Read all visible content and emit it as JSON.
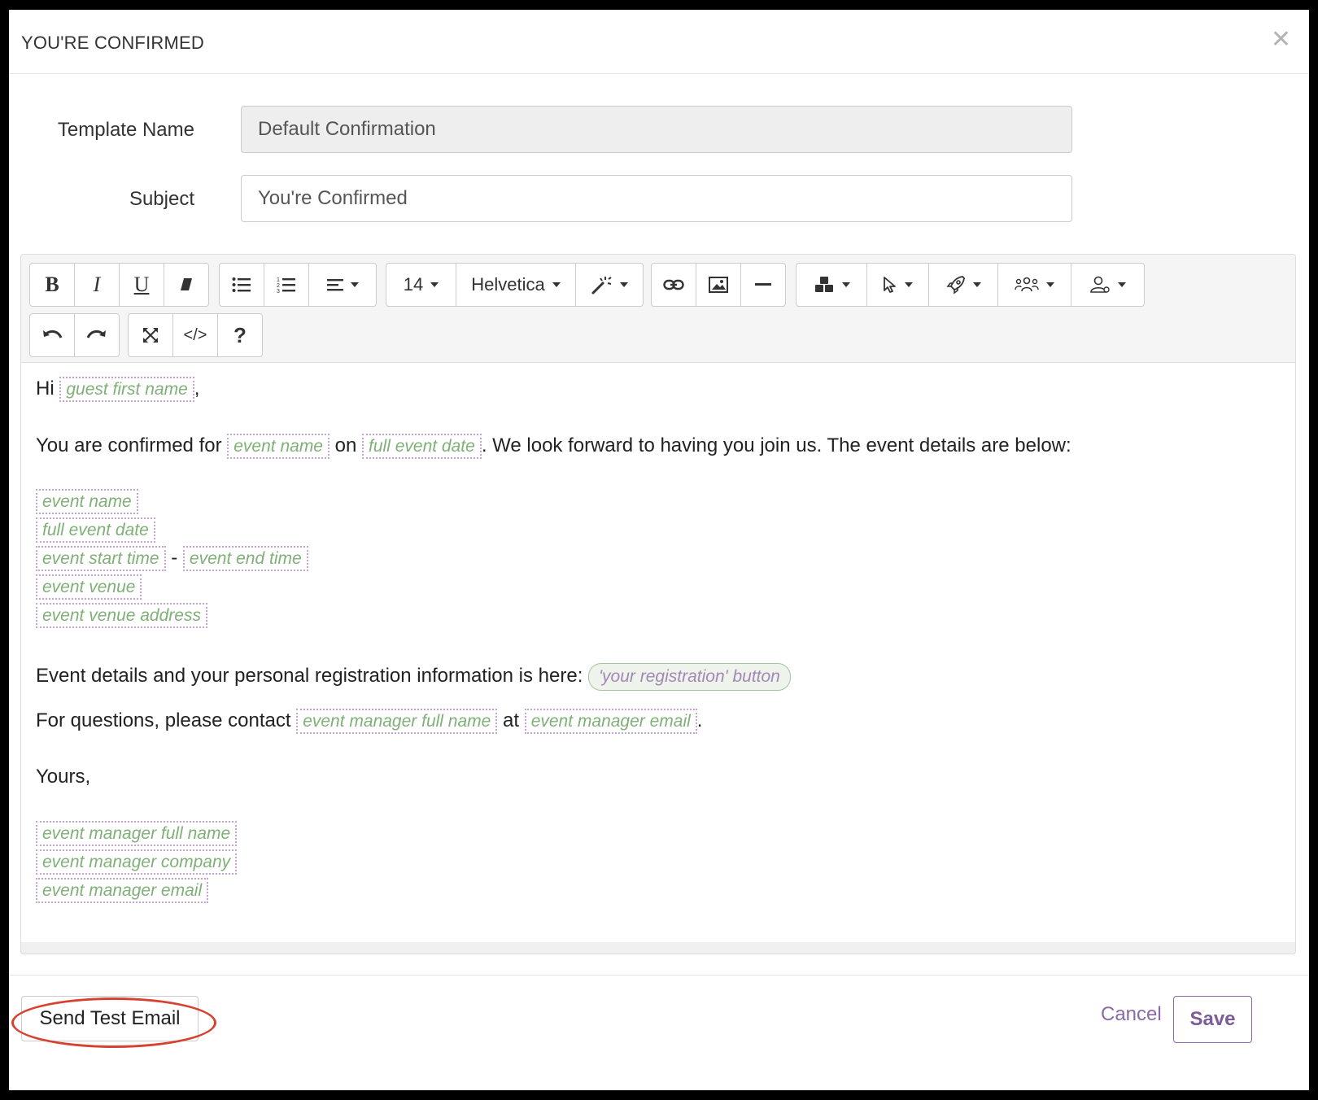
{
  "modal": {
    "title": "YOU'RE CONFIRMED",
    "close_glyph": "✕"
  },
  "form": {
    "template_name_label": "Template Name",
    "template_name_value": "Default Confirmation",
    "subject_label": "Subject",
    "subject_value": "You're Confirmed"
  },
  "toolbar": {
    "bold": "B",
    "italic": "I",
    "underline": "U",
    "font_size": "14",
    "font_family": "Helvetica",
    "code_view": "</>",
    "help": "?"
  },
  "body": {
    "greeting": "Hi",
    "greeting_tag": "guest first name",
    "greeting_end": ",",
    "confirm_text1": "You are confirmed for",
    "confirm_tag1": "event name",
    "confirm_text2": "on",
    "confirm_tag2": "full event date",
    "confirm_text3": ". We look forward to having you join us. The event details are below:",
    "detail_event_name": "event name",
    "detail_full_event_date": "full event date",
    "detail_start_time": "event start time",
    "detail_dash": "-",
    "detail_end_time": "event end time",
    "detail_venue": "event venue",
    "detail_venue_address": "event venue address",
    "registration_text": "Event details and your personal registration information is here:",
    "registration_button": "'your registration' button",
    "questions_text1": "For questions, please contact",
    "questions_tag1": "event manager full name",
    "questions_text2": "at",
    "questions_tag2": "event manager email",
    "questions_end": ".",
    "closing": "Yours,",
    "sig_full_name": "event manager full name",
    "sig_company": "event manager company",
    "sig_email": "event manager email"
  },
  "footer": {
    "send_test_label": "Send Test Email",
    "cancel_label": "Cancel",
    "save_label": "Save"
  },
  "colors": {
    "accent": "#7c5b99",
    "tag_text": "#7fb077",
    "tag_border": "#c7a2d4",
    "highlight_oval": "#d7412f"
  }
}
